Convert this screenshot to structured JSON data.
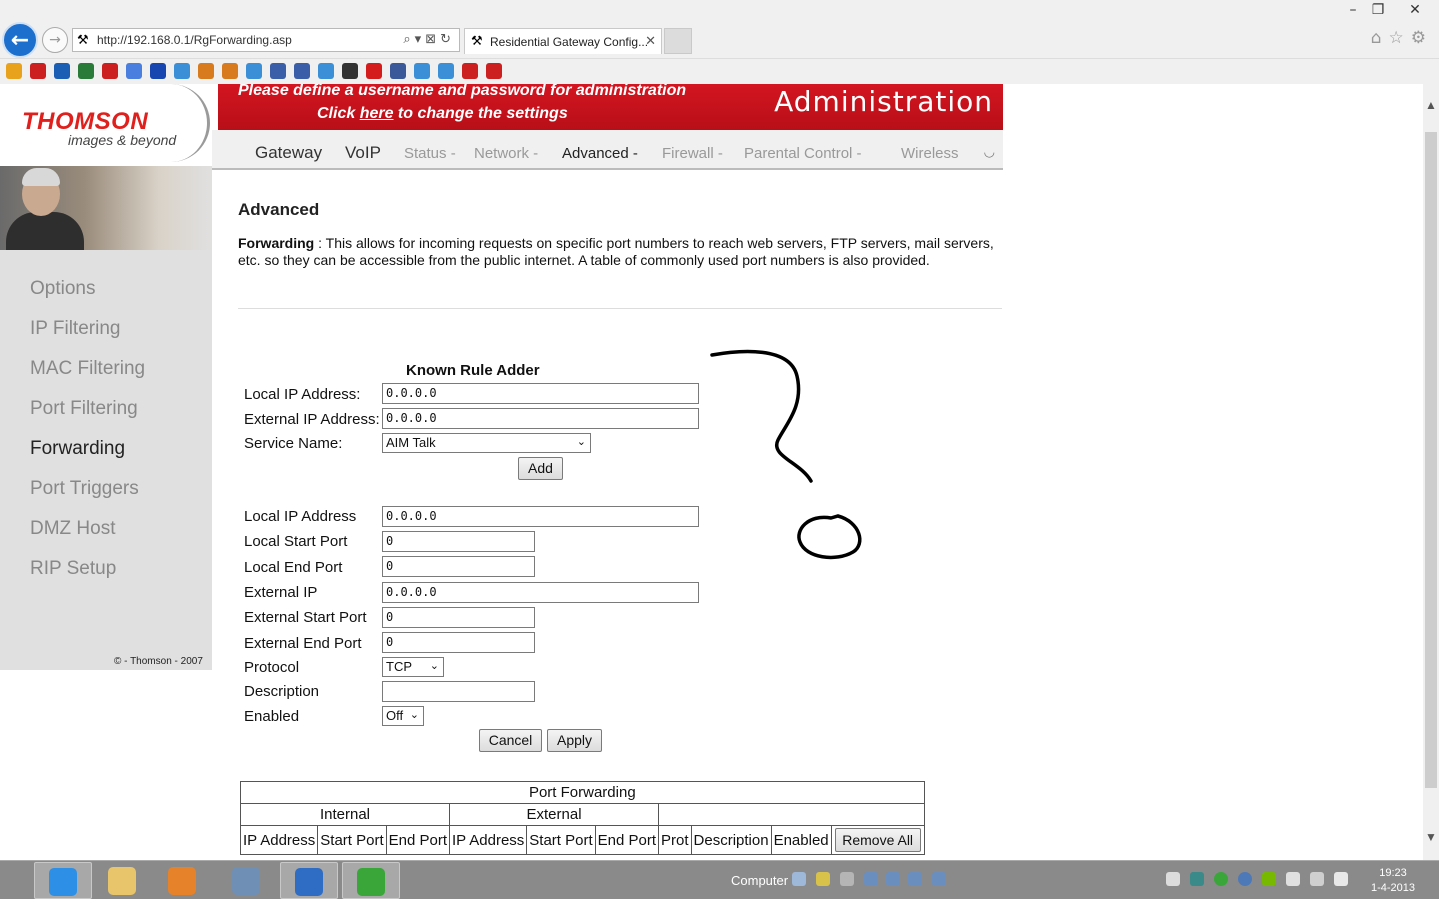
{
  "browser": {
    "url": "http://192.168.0.1/RgForwarding.asp",
    "tab_title": "Residential Gateway Config...",
    "window_controls": [
      "minimize",
      "restore",
      "close"
    ],
    "right_icons": [
      "home-icon",
      "star-icon",
      "gear-icon"
    ]
  },
  "favorites": [
    {
      "icon": "add-favorite-icon",
      "color": "#e8a21c"
    },
    {
      "icon": "youtube-icon",
      "color": "#cc1f1f"
    },
    {
      "icon": "app-icon",
      "color": "#1b5fb5"
    },
    {
      "icon": "globe-icon",
      "color": "#2a7a3a"
    },
    {
      "icon": "youtube-icon",
      "color": "#cc1f1f"
    },
    {
      "icon": "google-icon",
      "color": "#4a7fe0"
    },
    {
      "icon": "help-icon",
      "color": "#1846b0"
    },
    {
      "icon": "ie-page-icon",
      "color": "#3b8fd6"
    },
    {
      "icon": "bookmark-icon",
      "color": "#d87b1e"
    },
    {
      "icon": "bookmark-icon",
      "color": "#d87b1e"
    },
    {
      "icon": "ie-page-icon",
      "color": "#3b8fd6"
    },
    {
      "icon": "link-icon",
      "color": "#3a5ea8"
    },
    {
      "icon": "link-icon",
      "color": "#3a5ea8"
    },
    {
      "icon": "ie-page-icon",
      "color": "#3b8fd6"
    },
    {
      "icon": "owl-icon",
      "color": "#333333"
    },
    {
      "icon": "vodafone-icon",
      "color": "#d51c1c"
    },
    {
      "icon": "facebook-icon",
      "color": "#3b5998"
    },
    {
      "icon": "ie-page-icon",
      "color": "#3b8fd6"
    },
    {
      "icon": "ie-page-icon",
      "color": "#3b8fd6"
    },
    {
      "icon": "youtube-icon",
      "color": "#cc1f1f"
    },
    {
      "icon": "youtube-icon",
      "color": "#cc1f1f"
    }
  ],
  "header": {
    "brand": "THOMSON",
    "tagline": "images & beyond",
    "banner_line1": "Please define a username and password for administration",
    "banner_line2_pre": "Click ",
    "banner_line2_link": "here",
    "banner_line2_post": " to change the settings",
    "banner_title": "Administration",
    "brand_color": "#d31520"
  },
  "nav": {
    "gateway": "Gateway",
    "voip": "VoIP",
    "items": [
      "Status -",
      "Network -",
      "Advanced -",
      "Firewall -",
      "Parental Control -",
      "Wireless"
    ],
    "active": "Advanced -"
  },
  "sidebar": {
    "items": [
      "Options",
      "IP Filtering",
      "MAC Filtering",
      "Port Filtering",
      "Forwarding",
      "Port Triggers",
      "DMZ Host",
      "RIP Setup"
    ],
    "active": "Forwarding",
    "copyright": "© - Thomson - 2007"
  },
  "main": {
    "title": "Advanced",
    "desc_label": "Forwarding",
    "desc_sep": " : ",
    "desc_text": " This allows for incoming requests on specific port numbers to reach web servers, FTP servers, mail servers, etc. so they can be accessible from the public internet. A table of commonly used port numbers is also provided."
  },
  "known_rule_adder": {
    "title": "Known Rule Adder",
    "local_ip_label": "Local IP Address:",
    "local_ip_value": "0.0.0.0",
    "external_ip_label": "External IP Address:",
    "external_ip_value": "0.0.0.0",
    "service_label": "Service Name:",
    "service_value": "AIM Talk",
    "add_button": "Add"
  },
  "rule_form": {
    "local_ip_label": "Local IP Address",
    "local_ip_value": "0.0.0.0",
    "local_start_label": "Local Start Port",
    "local_start_value": "0",
    "local_end_label": "Local End Port",
    "local_end_value": "0",
    "external_ip_label": "External IP",
    "external_ip_value": "0.0.0.0",
    "external_start_label": "External Start Port",
    "external_start_value": "0",
    "external_end_label": "External End Port",
    "external_end_value": "0",
    "protocol_label": "Protocol",
    "protocol_value": "TCP",
    "description_label": "Description",
    "description_value": "",
    "enabled_label": "Enabled",
    "enabled_value": "Off",
    "cancel_button": "Cancel",
    "apply_button": "Apply"
  },
  "port_forwarding_table": {
    "title": "Port Forwarding",
    "group_internal": "Internal",
    "group_external": "External",
    "columns": [
      "IP Address",
      "Start Port",
      "End Port",
      "IP Address",
      "Start Port",
      "End Port",
      "Prot",
      "Description",
      "Enabled"
    ],
    "remove_all_button": "Remove All"
  },
  "taskbar": {
    "apps": [
      {
        "icon": "internet-explorer-icon",
        "color": "#2d8fe6",
        "active": true
      },
      {
        "icon": "file-explorer-icon",
        "color": "#e8c46a",
        "active": false
      },
      {
        "icon": "media-player-icon",
        "color": "#e5822a",
        "active": false
      },
      {
        "icon": "calculator-icon",
        "color": "#6f8fb5",
        "active": false
      },
      {
        "icon": "outlook-icon",
        "color": "#2f6dc4",
        "active": true
      },
      {
        "icon": "utorrent-icon",
        "color": "#3aa63a",
        "active": true
      }
    ],
    "computer_label": "Computer",
    "time": "19:23",
    "date": "1-4-2013"
  }
}
